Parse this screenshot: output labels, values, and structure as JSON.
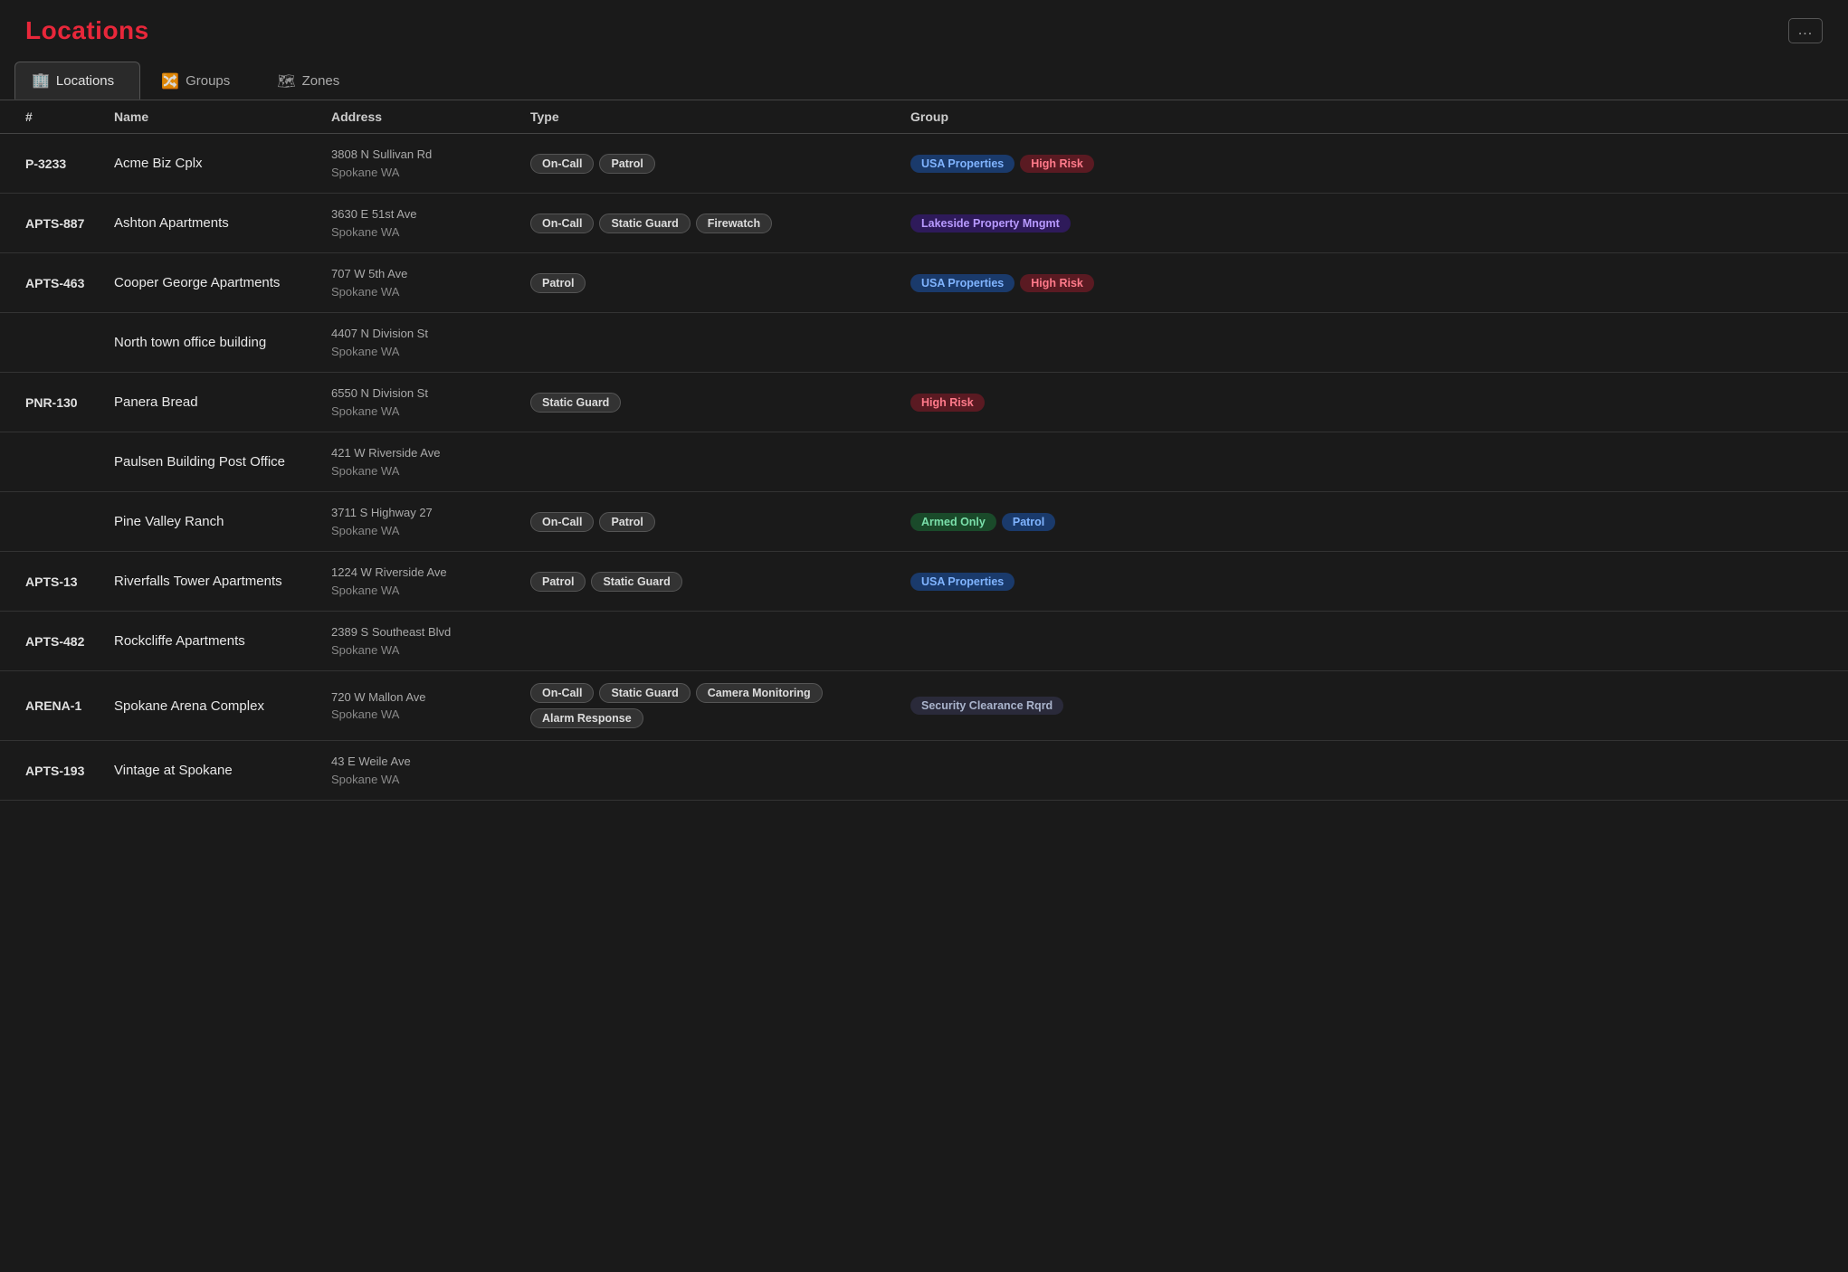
{
  "page": {
    "title": "Locations",
    "menu_btn": "..."
  },
  "tabs": [
    {
      "id": "locations",
      "label": "Locations",
      "icon": "🏢",
      "active": true
    },
    {
      "id": "groups",
      "label": "Groups",
      "icon": "🔀",
      "active": false
    },
    {
      "id": "zones",
      "label": "Zones",
      "icon": "🗺",
      "active": false
    }
  ],
  "table": {
    "columns": [
      "#",
      "Name",
      "Address",
      "Type",
      "Group"
    ],
    "rows": [
      {
        "number": "P-3233",
        "name": "Acme Biz Cplx",
        "addr1": "3808 N Sullivan Rd",
        "addr2": "Spokane WA",
        "types": [
          "On-Call",
          "Patrol"
        ],
        "groups": [
          {
            "label": "USA Properties",
            "style": "blue"
          },
          {
            "label": "High Risk",
            "style": "red"
          }
        ]
      },
      {
        "number": "APTS-887",
        "name": "Ashton Apartments",
        "addr1": "3630 E 51st Ave",
        "addr2": "Spokane WA",
        "types": [
          "On-Call",
          "Static Guard",
          "Firewatch"
        ],
        "groups": [
          {
            "label": "Lakeside Property Mngmt",
            "style": "purple"
          }
        ]
      },
      {
        "number": "APTS-463",
        "name": "Cooper George Apartments",
        "addr1": "707 W 5th Ave",
        "addr2": "Spokane WA",
        "types": [
          "Patrol"
        ],
        "groups": [
          {
            "label": "USA Properties",
            "style": "blue"
          },
          {
            "label": "High Risk",
            "style": "red"
          }
        ]
      },
      {
        "number": "",
        "name": "North town office building",
        "addr1": "4407 N Division St",
        "addr2": "Spokane WA",
        "types": [],
        "groups": []
      },
      {
        "number": "PNR-130",
        "name": "Panera Bread",
        "addr1": "6550 N Division St",
        "addr2": "Spokane WA",
        "types": [
          "Static Guard"
        ],
        "groups": [
          {
            "label": "High Risk",
            "style": "red"
          }
        ]
      },
      {
        "number": "",
        "name": "Paulsen Building Post Office",
        "addr1": "421 W Riverside Ave",
        "addr2": "Spokane WA",
        "types": [],
        "groups": []
      },
      {
        "number": "",
        "name": "Pine Valley Ranch",
        "addr1": "3711 S Highway 27",
        "addr2": "Spokane WA",
        "types": [
          "On-Call",
          "Patrol"
        ],
        "groups": [
          {
            "label": "Armed Only",
            "style": "green"
          },
          {
            "label": "Patrol",
            "style": "blue"
          }
        ]
      },
      {
        "number": "APTS-13",
        "name": "Riverfalls Tower Apartments",
        "addr1": "1224 W Riverside Ave",
        "addr2": "Spokane WA",
        "types": [
          "Patrol",
          "Static Guard"
        ],
        "groups": [
          {
            "label": "USA Properties",
            "style": "blue"
          }
        ]
      },
      {
        "number": "APTS-482",
        "name": "Rockcliffe Apartments",
        "addr1": "2389 S Southeast Blvd",
        "addr2": "Spokane WA",
        "types": [],
        "groups": []
      },
      {
        "number": "ARENA-1",
        "name": "Spokane Arena Complex",
        "addr1": "720 W Mallon Ave",
        "addr2": "Spokane WA",
        "types": [
          "On-Call",
          "Static Guard",
          "Camera Monitoring",
          "Alarm Response"
        ],
        "groups": [
          {
            "label": "Security Clearance Rqrd",
            "style": "gray"
          }
        ]
      },
      {
        "number": "APTS-193",
        "name": "Vintage at Spokane",
        "addr1": "43 E Weile Ave",
        "addr2": "Spokane WA",
        "types": [],
        "groups": []
      }
    ]
  }
}
